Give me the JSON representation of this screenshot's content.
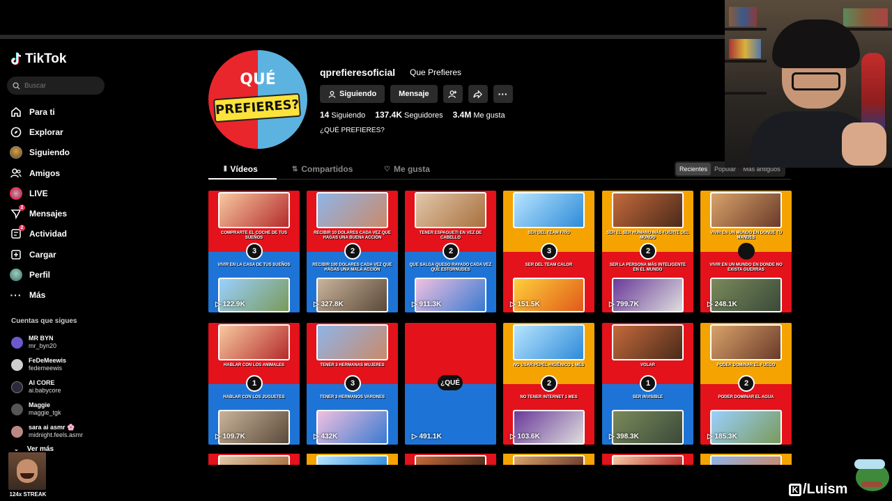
{
  "app": {
    "name": "TikTok"
  },
  "search": {
    "placeholder": "Buscar"
  },
  "nav": [
    {
      "label": "Para ti",
      "icon": "home-icon"
    },
    {
      "label": "Explorar",
      "icon": "compass-icon"
    },
    {
      "label": "Siguiendo",
      "icon": "following-avatar-icon"
    },
    {
      "label": "Amigos",
      "icon": "friends-icon"
    },
    {
      "label": "LIVE",
      "icon": "live-icon"
    },
    {
      "label": "Mensajes",
      "icon": "messages-icon",
      "badge": "2"
    },
    {
      "label": "Actividad",
      "icon": "activity-icon",
      "badge": "2"
    },
    {
      "label": "Cargar",
      "icon": "upload-icon"
    },
    {
      "label": "Perfil",
      "icon": "profile-avatar-icon"
    },
    {
      "label": "Más",
      "icon": "more-dots-icon"
    }
  ],
  "following_section": {
    "title": "Cuentas que sigues",
    "accounts": [
      {
        "name": "MR BYN",
        "handle": "mr_byn20",
        "color": "#6a5acd"
      },
      {
        "name": "FeDeMeewis",
        "handle": "fedemeewis",
        "color": "#cfcfcf"
      },
      {
        "name": "AI CORE",
        "handle": "ai.babycore",
        "color": "#2a2a3a"
      },
      {
        "name": "Maggie",
        "handle": "maggie_tgk",
        "color": "#555"
      },
      {
        "name": "sara ai asmr 🌸",
        "handle": "midnight.feels.asmr",
        "color": "#b88"
      }
    ],
    "more_label": "Ver más"
  },
  "streak": {
    "label": "124x STREAK"
  },
  "profile": {
    "username": "qprefieresoficial",
    "nickname": "Que Prefieres",
    "avatar_text_top": "QUÉ",
    "avatar_text_bottom": "PREFIERES?",
    "buttons": {
      "following": "Siguiendo",
      "message": "Mensaje"
    },
    "stats": {
      "following_count": "14",
      "following_label": "Siguiendo",
      "followers_count": "137.4K",
      "followers_label": "Seguidores",
      "likes_count": "3.4M",
      "likes_label": "Me gusta"
    },
    "bio": "¿QUÉ PREFIERES?"
  },
  "tabs": [
    {
      "label": "Vídeos",
      "active": true
    },
    {
      "label": "Compartidos",
      "active": false
    },
    {
      "label": "Me gusta",
      "active": false
    }
  ],
  "sort": [
    "Recientes",
    "Popular",
    "Más antiguos"
  ],
  "colors": {
    "red": "#e3121b",
    "blue": "#1e74d6",
    "orange": "#f5a300",
    "accent": "#fe2c55"
  },
  "videos": [
    {
      "top_caption": "Comprarte el coche de tus sueños",
      "bottom_caption": "Vivir en la casa de tus sueños",
      "number": "3",
      "views": "122.9K",
      "top_color": "#e3121b",
      "bottom_color": "#1e74d6"
    },
    {
      "top_caption": "Recibir 10 dolares cada vez que hagas una buena acción",
      "bottom_caption": "Recibir 100 dolares cada vez que hagas una mala acción",
      "number": "2",
      "views": "327.8K",
      "top_color": "#e3121b",
      "bottom_color": "#1e74d6"
    },
    {
      "top_caption": "Tener espagueti en vez de cabello",
      "bottom_caption": "Que salga queso rayado cada vez que estornudes",
      "number": "2",
      "views": "911.3K",
      "top_color": "#e3121b",
      "bottom_color": "#1e74d6"
    },
    {
      "top_caption": "Ser del team frío",
      "bottom_caption": "Ser del team calor",
      "number": "3",
      "views": "151.5K",
      "top_color": "#f5a300",
      "bottom_color": "#e3121b"
    },
    {
      "top_caption": "Ser el ser humano más fuerte del mundo",
      "bottom_caption": "Ser la persona más inteligente en el mundo",
      "number": "2",
      "views": "799.7K",
      "top_color": "#f5a300",
      "bottom_color": "#e3121b"
    },
    {
      "top_caption": "Vivir en un mundo en donde tú mandes",
      "bottom_caption": "Vivir en un mundo en donde no exista guerras",
      "number": "",
      "views": "248.1K",
      "top_color": "#f5a300",
      "bottom_color": "#e3121b"
    },
    {
      "top_caption": "Hablar con los animales",
      "bottom_caption": "Hablar con los juguetes",
      "number": "1",
      "views": "109.7K",
      "top_color": "#e3121b",
      "bottom_color": "#1e74d6"
    },
    {
      "top_caption": "Tener 3 hermanas mujeres",
      "bottom_caption": "Tener 3 hermanos varones",
      "number": "3",
      "views": "432K",
      "top_color": "#e3121b",
      "bottom_color": "#1e74d6"
    },
    {
      "top_caption": "",
      "bottom_caption": "",
      "number": "¿QUÉ",
      "views": "491.1K",
      "top_color": "#e3121b",
      "bottom_color": "#1e74d6",
      "placeholder": true
    },
    {
      "top_caption": "No usar pepel higiénico 1 mes",
      "bottom_caption": "No tener internet 1 mes",
      "number": "2",
      "views": "103.6K",
      "top_color": "#f5a300",
      "bottom_color": "#e3121b"
    },
    {
      "top_caption": "Volar",
      "bottom_caption": "Ser invisible",
      "number": "1",
      "views": "398.3K",
      "top_color": "#e3121b",
      "bottom_color": "#1e74d6"
    },
    {
      "top_caption": "Poder dominar el fuego",
      "bottom_caption": "Poder dominar el agua",
      "number": "2",
      "views": "185.3K",
      "top_color": "#f5a300",
      "bottom_color": "#e3121b"
    }
  ],
  "overlay": {
    "kick_label": "/Luism"
  }
}
